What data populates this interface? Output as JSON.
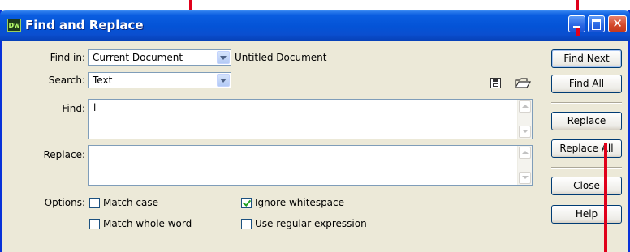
{
  "window": {
    "title": "Find and Replace",
    "app_icon_text": "Dw"
  },
  "find_in": {
    "label": "Find in:",
    "value": "Current Document",
    "scope_text": "Untitled Document"
  },
  "search": {
    "label": "Search:",
    "value": "Text"
  },
  "find": {
    "label": "Find:",
    "value": "l"
  },
  "replace": {
    "label": "Replace:",
    "value": ""
  },
  "options": {
    "label": "Options:",
    "match_case": {
      "label": "Match case",
      "checked": false
    },
    "ignore_whitespace": {
      "label": "Ignore whitespace",
      "checked": true
    },
    "match_whole_word": {
      "label": "Match whole word",
      "checked": false
    },
    "use_regex": {
      "label": "Use regular expression",
      "checked": false
    }
  },
  "buttons": {
    "find_next": "Find Next",
    "find_all": "Find All",
    "replace": "Replace",
    "replace_all": "Replace All",
    "close": "Close",
    "help": "Help"
  },
  "colors": {
    "annotation_marker": "#e0001b",
    "title_bar": "#0453d6",
    "dialog_bg": "#ece9d8"
  }
}
